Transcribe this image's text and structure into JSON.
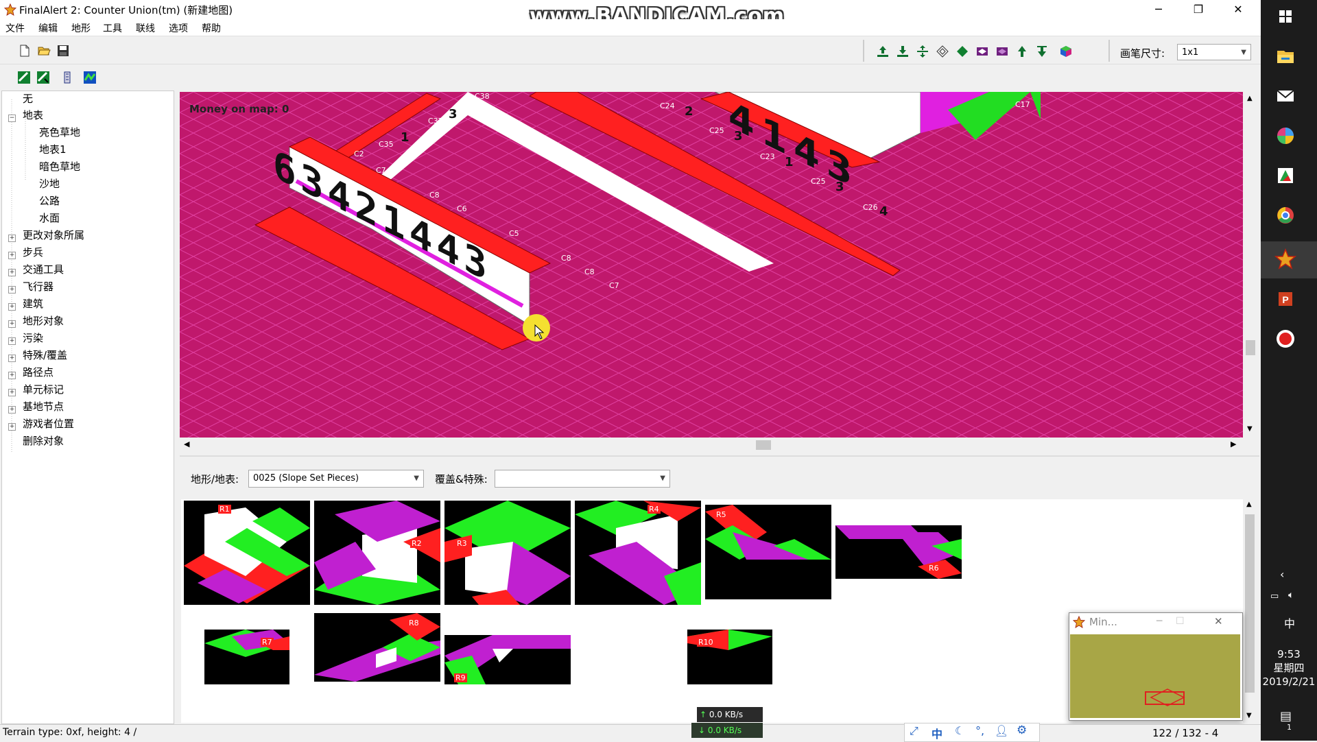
{
  "window": {
    "title": "FinalAlert 2: Counter Union(tm) (新建地图)",
    "watermark": "www.BANDICAM.com",
    "controls": [
      "─",
      "❐",
      "✕"
    ]
  },
  "menu": [
    "文件",
    "编辑",
    "地形",
    "工具",
    "联线",
    "选项",
    "帮助"
  ],
  "toolbar": {
    "brush_label": "画笔尺寸:",
    "brush_value": "1x1"
  },
  "tree": {
    "items": [
      {
        "label": "无",
        "level": 0,
        "expander": ""
      },
      {
        "label": "地表",
        "level": 0,
        "expander": "−"
      },
      {
        "label": "亮色草地",
        "level": 1,
        "expander": ""
      },
      {
        "label": "地表1",
        "level": 1,
        "expander": ""
      },
      {
        "label": "暗色草地",
        "level": 1,
        "expander": ""
      },
      {
        "label": "沙地",
        "level": 1,
        "expander": ""
      },
      {
        "label": "公路",
        "level": 1,
        "expander": ""
      },
      {
        "label": "水面",
        "level": 1,
        "expander": ""
      },
      {
        "label": "更改对象所属",
        "level": 0,
        "expander": "+"
      },
      {
        "label": "步兵",
        "level": 0,
        "expander": "+"
      },
      {
        "label": "交通工具",
        "level": 0,
        "expander": "+"
      },
      {
        "label": "飞行器",
        "level": 0,
        "expander": "+"
      },
      {
        "label": "建筑",
        "level": 0,
        "expander": "+"
      },
      {
        "label": "地形对象",
        "level": 0,
        "expander": "+"
      },
      {
        "label": "污染",
        "level": 0,
        "expander": "+"
      },
      {
        "label": "特殊/覆盖",
        "level": 0,
        "expander": "+"
      },
      {
        "label": "路径点",
        "level": 0,
        "expander": "+"
      },
      {
        "label": "单元标记",
        "level": 0,
        "expander": "+"
      },
      {
        "label": "基地节点",
        "level": 0,
        "expander": "+"
      },
      {
        "label": "游戏者位置",
        "level": 0,
        "expander": "+"
      },
      {
        "label": "删除对象",
        "level": 0,
        "expander": ""
      }
    ]
  },
  "map": {
    "money_text": "Money on map: 0",
    "wall_digits": [
      "6",
      "3",
      "4",
      "2",
      "1",
      "4",
      "4",
      "3"
    ],
    "labels": [
      "C2",
      "C7",
      "C35",
      "C37",
      "C38",
      "C8",
      "C6",
      "C5",
      "C8",
      "C8",
      "C7",
      "C24",
      "C25",
      "C23",
      "C25",
      "C26",
      "C17"
    ],
    "small_digits": [
      "1",
      "3",
      "2",
      "3",
      "1",
      "3",
      "4"
    ],
    "top_right_digits": [
      "4",
      "1",
      "4",
      "3"
    ]
  },
  "lower": {
    "terrain_label": "地形/地表:",
    "terrain_value": "0025 (Slope Set Pieces)",
    "overlay_label": "覆盖&特殊:",
    "overlay_value": "",
    "tiles": [
      "R1",
      "R2",
      "R3",
      "R4",
      "R5",
      "R6",
      "R7",
      "R8",
      "R9",
      "R10"
    ]
  },
  "status": {
    "text": "Terrain type: 0xf, height: 4 /",
    "coords": "122 / 132 - 4",
    "net_up": "0.0 KB/s",
    "net_down": "0.0 KB/s"
  },
  "ime_bar_icons": [
    "expand-icon",
    "中",
    "moon-icon",
    "punctuation-icon",
    "user-icon",
    "gear-icon"
  ],
  "mini_window": {
    "title": "Min..."
  },
  "taskbar": {
    "ime": "中",
    "time": "9:53",
    "weekday": "星期四",
    "date": "2019/2/21",
    "notification_count": "1"
  },
  "colors": {
    "map_bg": "#c0186c",
    "wall_red": "#ff1a1a",
    "slope_green": "#22ee22",
    "slope_purple": "#c020d0"
  }
}
